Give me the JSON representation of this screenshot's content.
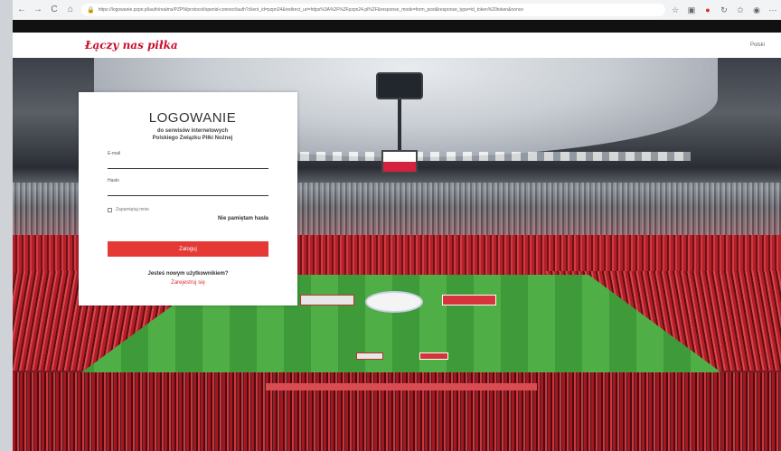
{
  "browser": {
    "url": "https://logowanie.pzpn.pl/auth/realms/PZPN/protocol/openid-connect/auth?client_id=pzpn24&redirect_uri=https%3A%2F%2Fpzpn24.pl%2F&response_mode=form_post&response_type=id_token%20token&nonce",
    "back_icon": "←",
    "forward_icon": "→",
    "reload_icon": "C",
    "home_icon": "⌂",
    "lock_icon": "🔒"
  },
  "site": {
    "logo_text": "Łączy nas piłka",
    "header_link": "Polski"
  },
  "login": {
    "title": "LOGOWANIE",
    "subtitle_line1": "do serwisów internetowych",
    "subtitle_line2": "Polskiego Związku Piłki Nożnej",
    "email_label": "E-mail",
    "password_label": "Hasło",
    "remember_label": "Zapamiętaj mnie",
    "forgot_label": "Nie pamiętam hasła",
    "submit_label": "Zaloguj",
    "new_user_text": "Jesteś nowym użytkownikiem?",
    "register_link": "Zarejestruj się"
  },
  "colors": {
    "brand_red": "#e53935",
    "logo_red": "#c8102e"
  }
}
